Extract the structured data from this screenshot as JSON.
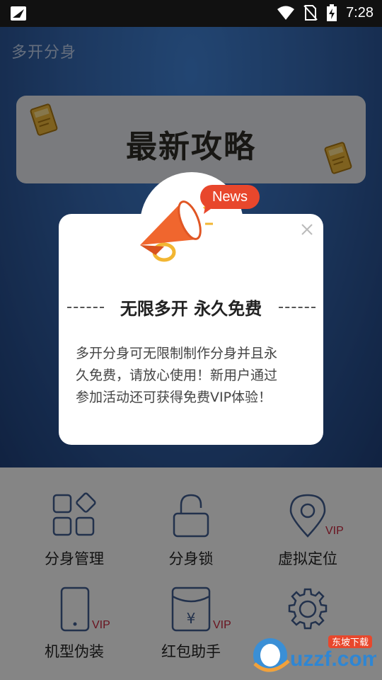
{
  "status_bar": {
    "time": "7:28",
    "icons": [
      "app-notification-icon",
      "wifi-icon",
      "no-sim-icon",
      "battery-charging-icon"
    ]
  },
  "header": {
    "app_title": "多开分身"
  },
  "banner": {
    "title": "最新攻略",
    "book_label": "攻略"
  },
  "grid": {
    "items": [
      {
        "label": "分身管理",
        "icon": "apps-grid-icon",
        "vip": ""
      },
      {
        "label": "分身锁",
        "icon": "lock-icon",
        "vip": ""
      },
      {
        "label": "虚拟定位",
        "icon": "location-pin-icon",
        "vip": "VIP"
      },
      {
        "label": "机型伪装",
        "icon": "phone-icon",
        "vip": "VIP"
      },
      {
        "label": "红包助手",
        "icon": "red-envelope-icon",
        "vip": "VIP"
      },
      {
        "label": "",
        "icon": "settings-gear-icon",
        "vip": ""
      }
    ]
  },
  "dialog": {
    "badge": "News",
    "heading": "无限多开  永久免费",
    "body_lines": [
      "多开分身可无限制制作分身并且永",
      "久免费，请放心使用！新用户通过",
      "参加活动还可获得免费VIP体验！"
    ],
    "close_icon": "close-icon",
    "image_icon": "megaphone-icon"
  },
  "watermark": {
    "brand": "uzzf.com",
    "cn_label": "东坡下载"
  },
  "colors": {
    "accent_orange": "#f0662e",
    "vip_red": "#c0243a",
    "icon_blue": "#3e5a8a"
  }
}
